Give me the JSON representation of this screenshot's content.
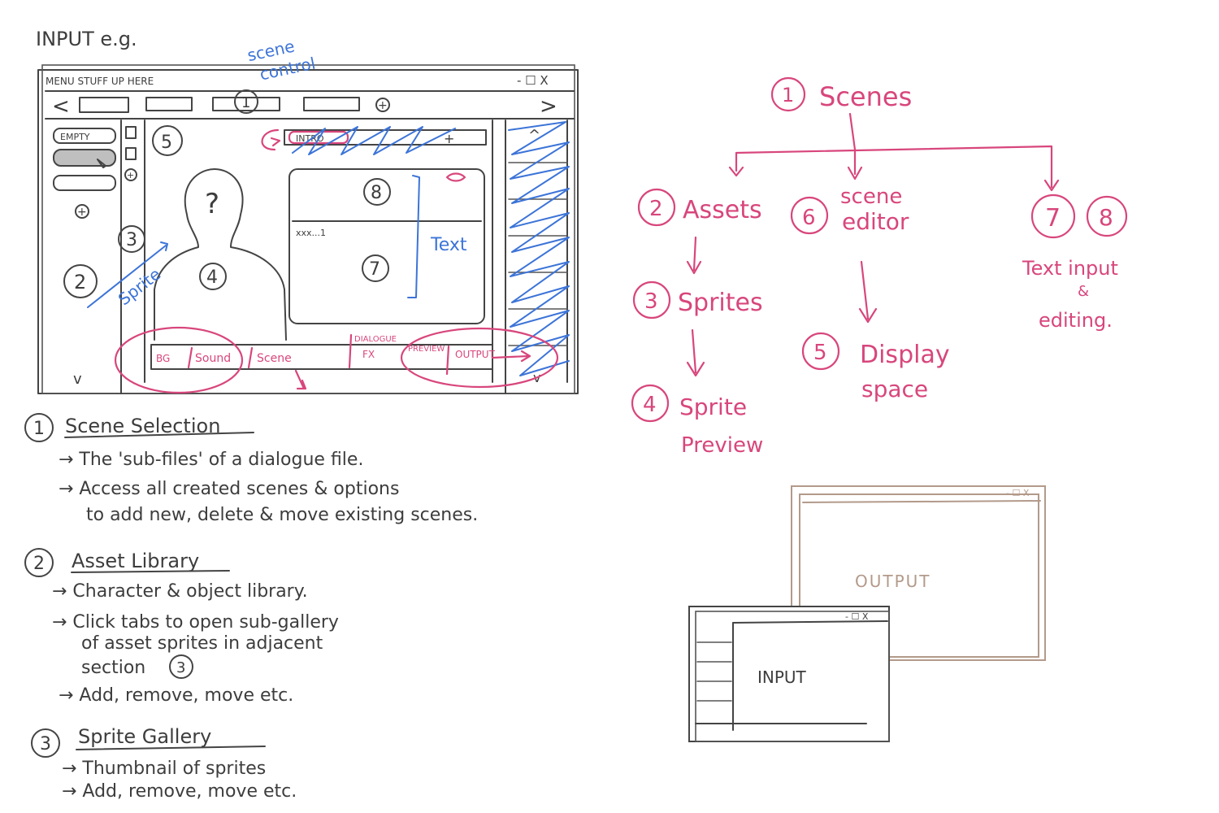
{
  "colors": {
    "ink": "#3d3d3d",
    "pink": "#d8467c",
    "blue": "#3c74d8",
    "tan": "#b39a8a"
  },
  "wireframe": {
    "heading": "INPUT e.g.",
    "menu_text": "MENU STUFF UP HERE",
    "window_buttons": "- ☐ X",
    "nav_prev": "<",
    "nav_next": ">",
    "tab_number": "1",
    "add_tab": "+",
    "empty_label": "EMPTY",
    "add_asset": "+",
    "add_gallery": "+",
    "scroll_down_left": "v",
    "scroll_up_right": "^",
    "scroll_down_right": "v",
    "sprite_placeholder": "?",
    "text_sample": "xxx...1",
    "bar_items": [
      "BG",
      "Sound",
      "Scene",
      "DIALOGUE",
      "FX",
      "PREVIEW",
      "OUTPUT"
    ],
    "bar_sub": "",
    "intro_label": "INTRO",
    "intro_add": "+",
    "markers": {
      "m2": "2",
      "m3": "3",
      "m4": "4",
      "m5": "5",
      "m7": "7",
      "m8": "8"
    },
    "annotations": {
      "scene_control": [
        "scene",
        "control"
      ],
      "sprite": "Sprite",
      "text": "Text"
    }
  },
  "hierarchy": {
    "scenes": {
      "num": "1",
      "label": "Scenes"
    },
    "assets": {
      "num": "2",
      "label": "Assets"
    },
    "scene_editor": {
      "num": "6",
      "label_lines": [
        "scene",
        "editor"
      ]
    },
    "text_input": {
      "nums": [
        "7",
        "8"
      ],
      "label_lines": [
        "Text input",
        "&",
        "editing."
      ]
    },
    "sprites": {
      "num": "3",
      "label": "Sprites"
    },
    "display_space": {
      "num": "5",
      "label_lines": [
        "Display",
        "space"
      ]
    },
    "sprite_preview": {
      "num": "4",
      "label_lines": [
        "Sprite",
        "Preview"
      ]
    }
  },
  "notes": [
    {
      "num": "1",
      "title": "Scene Selection",
      "lines": [
        "→ The 'sub-files' of a dialogue file.",
        "→ Access all created scenes & options",
        "to add new, delete & move existing scenes."
      ]
    },
    {
      "num": "2",
      "title": "Asset Library",
      "lines": [
        "→ Character & object library.",
        "→ Click tabs to open sub-gallery",
        "of asset sprites in adjacent",
        "section"
      ],
      "ref": "3",
      "extra": "→ Add, remove, move etc."
    },
    {
      "num": "3",
      "title": "Sprite Gallery",
      "lines": [
        "→ Thumbnail of sprites",
        "→ Add, remove, move etc."
      ]
    }
  ],
  "windows": {
    "output": {
      "label": "OUTPUT",
      "controls": "- ☐ X"
    },
    "input": {
      "label": "INPUT",
      "controls": "- ☐ X"
    }
  }
}
